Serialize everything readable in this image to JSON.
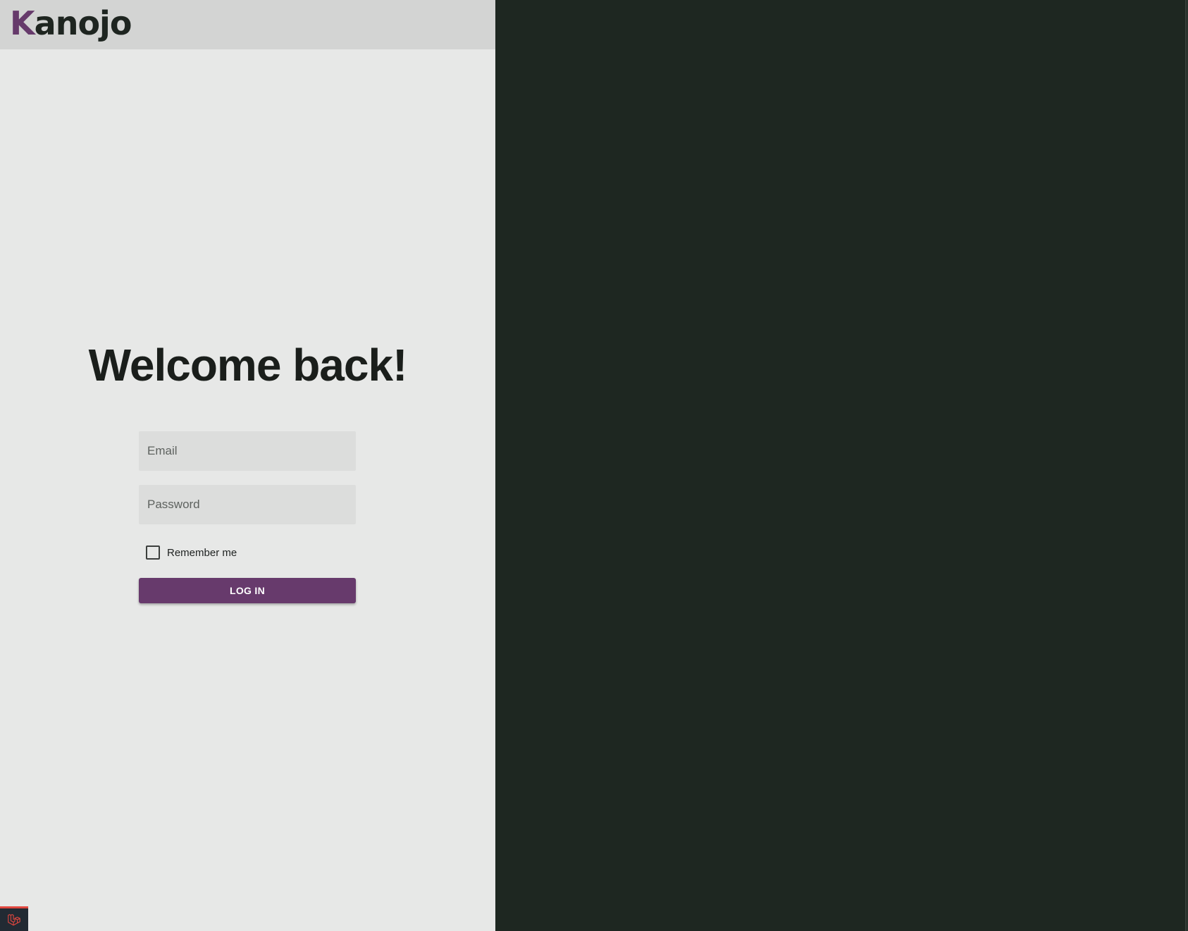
{
  "brand": {
    "logo_initial": "K",
    "logo_rest": "anojo",
    "accent_color": "#663a6b"
  },
  "login": {
    "heading": "Welcome back!",
    "email_placeholder": "Email",
    "password_placeholder": "Password",
    "remember_label": "Remember me",
    "remember_checked": false,
    "submit_label": "LOG IN"
  },
  "colors": {
    "left_panel_bg": "#e7e8e7",
    "right_panel_bg": "#1e2721",
    "button_bg": "#673a6c"
  },
  "debug_badge": {
    "icon": "laravel-icon"
  }
}
